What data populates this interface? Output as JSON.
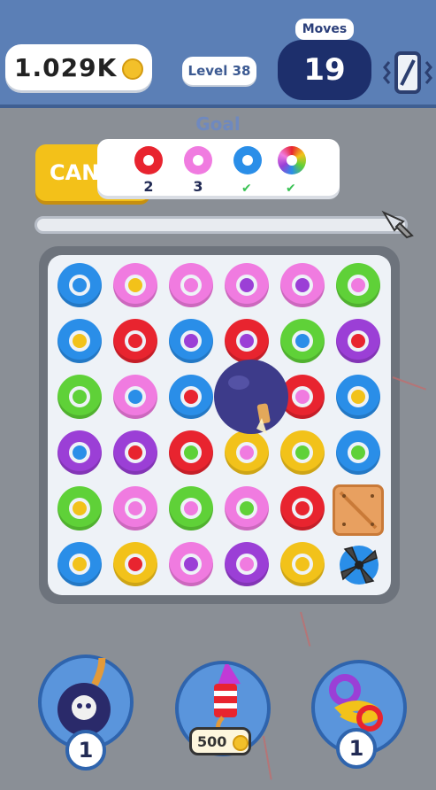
{
  "header": {
    "coins": "1.029K",
    "level": "Level 38",
    "moves_label": "Moves",
    "moves_value": "19"
  },
  "goal": {
    "title": "Goal",
    "cancel_label": "CAN",
    "items": [
      {
        "color": "#e8242f",
        "hole": "#ffffff",
        "count": "2",
        "done": false
      },
      {
        "color": "#f07be0",
        "hole": "#ffffff",
        "count": "3",
        "done": false
      },
      {
        "color": "#2a8ee8",
        "hole": "#ffffff",
        "count": "",
        "done": true
      },
      {
        "color": "rainbow",
        "hole": "#ffffff",
        "count": "",
        "done": true
      }
    ],
    "check_glyph": "✔"
  },
  "board": {
    "rows": [
      [
        [
          "#2a8ee8",
          "#2a8ee8"
        ],
        [
          "#f07be0",
          "#f2c21a"
        ],
        [
          "#f07be0",
          "#f07be0"
        ],
        [
          "#f07be0",
          "#9b3fd6"
        ],
        [
          "#f07be0",
          "#9b3fd6"
        ],
        [
          "#5fd138",
          "#f07be0"
        ]
      ],
      [
        [
          "#2a8ee8",
          "#f2c21a"
        ],
        [
          "#e8242f",
          "#e8242f"
        ],
        [
          "#2a8ee8",
          "#9b3fd6"
        ],
        [
          "#e8242f",
          "#9b3fd6"
        ],
        [
          "#5fd138",
          "#2a8ee8"
        ],
        [
          "#9b3fd6",
          "#e8242f"
        ]
      ],
      [
        [
          "#5fd138",
          "#5fd138"
        ],
        [
          "#f07be0",
          "#2a8ee8"
        ],
        [
          "#2a8ee8",
          "#e8242f"
        ],
        [
          "#9b3fd6",
          "#9b3fd6"
        ],
        [
          "#e8242f",
          "#f07be0"
        ],
        [
          "#2a8ee8",
          "#f2c21a"
        ]
      ],
      [
        [
          "#9b3fd6",
          "#2a8ee8"
        ],
        [
          "#9b3fd6",
          "#e8242f"
        ],
        [
          "#e8242f",
          "#5fd138"
        ],
        [
          "#f2c21a",
          "#f07be0"
        ],
        [
          "#f2c21a",
          "#5fd138"
        ],
        [
          "#2a8ee8",
          "#5fd138"
        ]
      ],
      [
        [
          "#5fd138",
          "#f2c21a"
        ],
        [
          "#f07be0",
          "#f07be0"
        ],
        [
          "#5fd138",
          "#f07be0"
        ],
        [
          "#f07be0",
          "#5fd138"
        ],
        [
          "#e8242f",
          "#e8242f"
        ],
        [
          "crate",
          "crate"
        ]
      ],
      [
        [
          "#2a8ee8",
          "#f2c21a"
        ],
        [
          "#f2c21a",
          "#e8242f"
        ],
        [
          "#f07be0",
          "#9b3fd6"
        ],
        [
          "#9b3fd6",
          "#f07be0"
        ],
        [
          "#f2c21a",
          "#f2c21a"
        ],
        [
          "fan",
          "fan"
        ]
      ]
    ]
  },
  "boosters": {
    "bomb_count": "1",
    "rocket_price": "500",
    "swap_count": "1"
  },
  "icons": {
    "coin": "coin-icon",
    "settings": "phone-vibrate-icon",
    "bomb": "bomb-icon",
    "rocket": "rocket-icon",
    "swap": "swap-icon",
    "crate": "crate-icon",
    "fan": "fan-icon"
  }
}
